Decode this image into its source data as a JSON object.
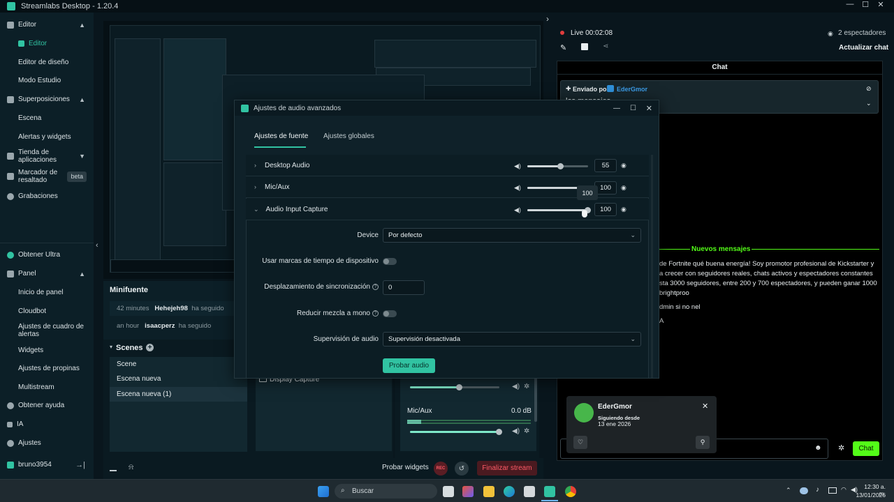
{
  "window": {
    "title": "Streamlabs Desktop - 1.20.4"
  },
  "sidebar": {
    "items": [
      {
        "label": "Editor",
        "icon": "editor-icon"
      },
      {
        "label": "Editor",
        "icon": "editor-sub-icon"
      },
      {
        "label": "Editor de diseño"
      },
      {
        "label": "Modo Estudio"
      },
      {
        "label": "Superposiciones",
        "icon": "overlays-icon"
      },
      {
        "label": "Escena"
      },
      {
        "label": "Alertas y widgets"
      },
      {
        "label": "Tienda de aplicaciones",
        "icon": "store-icon"
      },
      {
        "label": "Marcador de resaltado",
        "icon": "highlighter-icon",
        "badge": "beta"
      },
      {
        "label": "Grabaciones",
        "icon": "recordings-icon"
      },
      {
        "label": "Obtener Ultra",
        "icon": "ultra-icon"
      },
      {
        "label": "Panel",
        "icon": "panel-icon"
      },
      {
        "label": "Inicio de panel"
      },
      {
        "label": "Cloudbot"
      },
      {
        "label": "Ajustes de cuadro de alertas"
      },
      {
        "label": "Widgets"
      },
      {
        "label": "Ajustes de propinas"
      },
      {
        "label": "Multistream"
      },
      {
        "label": "Obtener ayuda",
        "icon": "help-icon"
      },
      {
        "label": "IA",
        "icon": "ai-icon"
      },
      {
        "label": "Ajustes",
        "icon": "settings-icon"
      },
      {
        "label": "bruno3954",
        "icon": "user-icon"
      }
    ]
  },
  "minifeed": {
    "title": "Minifuente",
    "rows": [
      {
        "time": "42 minutes",
        "user": "Hehejeh98",
        "action": "ha seguido"
      },
      {
        "time": "an hour",
        "user": "isaacperz",
        "action": "ha seguido"
      }
    ]
  },
  "scenes": {
    "title": "Scenes",
    "items": [
      "Scene",
      "Escena nueva",
      "Escena nueva (1)"
    ]
  },
  "sources_panel": {
    "item": "Display Capture"
  },
  "mixer": {
    "mic_label": "Mic/Aux",
    "mic_db": "0.0 dB"
  },
  "footer": {
    "test_widgets": "Probar widgets",
    "rec": "REC",
    "end_stream": "Finalizar stream"
  },
  "stream_info": {
    "live": "Live 00:02:08",
    "viewers": "2 espectadores",
    "refresh_chat": "Actualizar chat"
  },
  "chat": {
    "header": "Chat",
    "pinned_by_prefix": "Enviado por",
    "pinned_user": "EderGmor",
    "pinned_text": "los mensajes",
    "new_messages": "Nuevos mensajes",
    "messages": [
      "de Fortnite qué buena energía! Soy promotor profesional de Kickstarter y",
      "a crecer con seguidores reales, chats activos y espectadores constantes",
      "sta 3000 seguidores, entre 200 y 700 espectadores, y pueden ganar 1000",
      "brightproo",
      "dmin si no nel",
      "A"
    ],
    "send_button": "Chat"
  },
  "follower_card": {
    "name": "EderGmor",
    "following_since_label": "Siguiendo desde",
    "following_since_date": "13 ene 2026"
  },
  "modal": {
    "title": "Ajustes de audio avanzados",
    "tabs": [
      "Ajustes de fuente",
      "Ajustes globales"
    ],
    "tooltip": "100",
    "sources": [
      {
        "name": "Desktop Audio",
        "volume": 55
      },
      {
        "name": "Mic/Aux",
        "volume": 100
      },
      {
        "name": "Audio Input Capture",
        "volume": 100
      }
    ],
    "fields": {
      "device_label": "Device",
      "device_value": "Por defecto",
      "timestamps_label": "Usar marcas de tiempo de dispositivo",
      "sync_label": "Desplazamiento de sincronización",
      "sync_value": "0",
      "mono_label": "Reducir mezcla a mono",
      "monitor_label": "Supervisión de audio",
      "monitor_value": "Supervisión desactivada",
      "test_button": "Probar audio"
    }
  },
  "taskbar": {
    "search": "Buscar",
    "time": "12:30 a. m.",
    "date": "13/01/2026"
  },
  "colors": {
    "accent": "#31c3a2",
    "live_red": "#e03d3d",
    "chat_green": "#53fc18",
    "end_stream_bg": "#4a1a20",
    "end_stream_text": "#ff5a67"
  }
}
